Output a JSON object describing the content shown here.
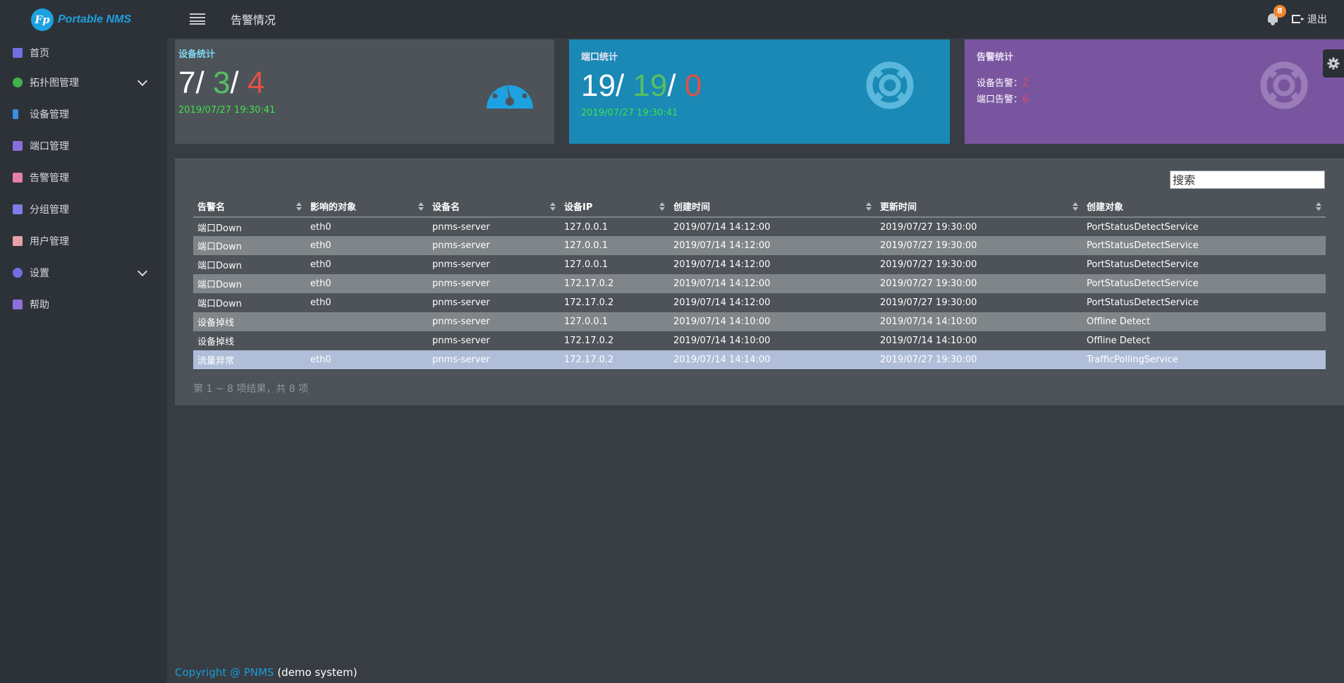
{
  "app": {
    "logo_text": "Portable NMS",
    "logo_mark": "Fp"
  },
  "sidebar": {
    "items": [
      {
        "label": "首页",
        "icon": "dashboard-icon",
        "color": "#6f6fe2"
      },
      {
        "label": "拓扑图管理",
        "icon": "globe-icon",
        "color": "#3fb24f",
        "expandable": true
      },
      {
        "label": "设备管理",
        "icon": "mobile-icon",
        "color": "#3a8fe0"
      },
      {
        "label": "端口管理",
        "icon": "server-icon",
        "color": "#8a6fd9"
      },
      {
        "label": "告警管理",
        "icon": "bell-icon",
        "color": "#e67fa7"
      },
      {
        "label": "分组管理",
        "icon": "list-icon",
        "color": "#7d7de8"
      },
      {
        "label": "用户管理",
        "icon": "user-icon",
        "color": "#e9a0a8"
      },
      {
        "label": "设置",
        "icon": "gear-icon",
        "color": "#6f6fe2",
        "expandable": true
      },
      {
        "label": "帮助",
        "icon": "users-icon",
        "color": "#8e6fe0"
      }
    ]
  },
  "header": {
    "title": "告警情况",
    "notification_count": "8",
    "logout_label": "退出"
  },
  "cards": {
    "device": {
      "title": "设备统计",
      "total": "7",
      "up": "3",
      "down": "4",
      "timestamp": "2019/07/27 19:30:41"
    },
    "port": {
      "title": "端口统计",
      "total": "19",
      "up": "19",
      "down": "0",
      "timestamp": "2019/07/27 19:30:41"
    },
    "alarm": {
      "title": "告警统计",
      "device_label": "设备告警：",
      "device_count": "2",
      "port_label": "端口告警：",
      "port_count": "6"
    }
  },
  "table": {
    "search_placeholder": "搜索",
    "columns": [
      "告警名",
      "影响的对象",
      "设备名",
      "设备IP",
      "创建时间",
      "更新时间",
      "创建对象"
    ],
    "rows": [
      [
        "端口Down",
        "eth0",
        "pnms-server",
        "127.0.0.1",
        "2019/07/14 14:12:00",
        "2019/07/27 19:30:00",
        "PortStatusDetectService"
      ],
      [
        "端口Down",
        "eth0",
        "pnms-server",
        "127.0.0.1",
        "2019/07/14 14:12:00",
        "2019/07/27 19:30:00",
        "PortStatusDetectService"
      ],
      [
        "端口Down",
        "eth0",
        "pnms-server",
        "127.0.0.1",
        "2019/07/14 14:12:00",
        "2019/07/27 19:30:00",
        "PortStatusDetectService"
      ],
      [
        "端口Down",
        "eth0",
        "pnms-server",
        "172.17.0.2",
        "2019/07/14 14:12:00",
        "2019/07/27 19:30:00",
        "PortStatusDetectService"
      ],
      [
        "端口Down",
        "eth0",
        "pnms-server",
        "172.17.0.2",
        "2019/07/14 14:12:00",
        "2019/07/27 19:30:00",
        "PortStatusDetectService"
      ],
      [
        "设备掉线",
        "",
        "pnms-server",
        "127.0.0.1",
        "2019/07/14 14:10:00",
        "2019/07/14 14:10:00",
        "Offline Detect"
      ],
      [
        "设备掉线",
        "",
        "pnms-server",
        "172.17.0.2",
        "2019/07/14 14:10:00",
        "2019/07/14 14:10:00",
        "Offline Detect"
      ],
      [
        "流量异常",
        "eth0",
        "pnms-server",
        "172.17.0.2",
        "2019/07/14 14:14:00",
        "2019/07/27 19:30:00",
        "TrafficPollingService"
      ]
    ],
    "info": "第 1 ~ 8 项结果，共 8 项"
  },
  "footer": {
    "link_text": "Copyright @ PNMS",
    "suffix": " (demo system)"
  }
}
